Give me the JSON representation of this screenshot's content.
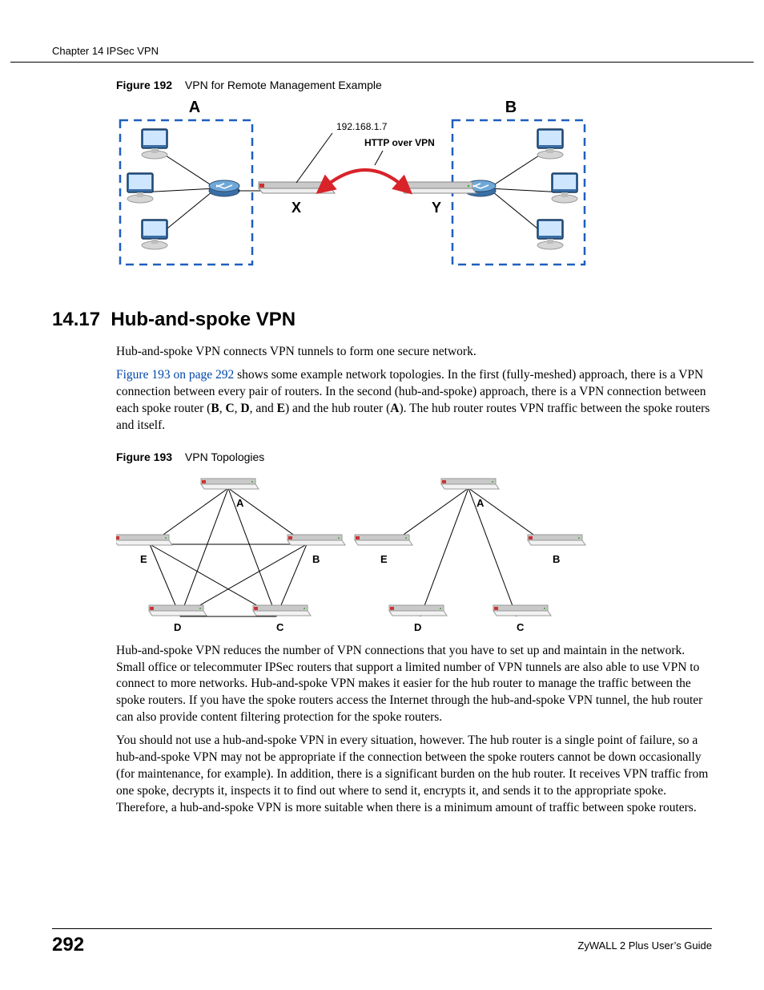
{
  "running_head": "Chapter 14 IPSec VPN",
  "figure192": {
    "label": "Figure 192",
    "title": "VPN for Remote Management Example",
    "site_a": "A",
    "site_b": "B",
    "node_x": "X",
    "node_y": "Y",
    "ip": "192.168.1.7",
    "tunnel_label": "HTTP over VPN"
  },
  "section": {
    "number": "14.17",
    "title": "Hub-and-spoke VPN"
  },
  "p1": "Hub-and-spoke VPN connects VPN tunnels to form one secure network.",
  "p2_xref": "Figure 193 on page 292",
  "p2_after_xref": " shows some example network topologies. In the first (fully-meshed) approach, there is a VPN connection between every pair of routers. In the second (hub-and-spoke) approach, there is a VPN connection between each spoke router (",
  "p2_b": "B",
  "p2_c": "C",
  "p2_d": "D",
  "p2_and": ", and ",
  "p2_e": "E",
  "p2_tail": ") and the hub router (",
  "p2_a": "A",
  "p2_end": "). The hub router routes VPN traffic between the spoke routers and itself.",
  "figure193": {
    "label": "Figure 193",
    "title": "VPN Topologies",
    "nodes": {
      "a": "A",
      "b": "B",
      "c": "C",
      "d": "D",
      "e": "E"
    }
  },
  "p3": "Hub-and-spoke VPN reduces the number of VPN connections that you have to set up and maintain in the network. Small office or telecommuter IPSec routers that support a limited number of VPN tunnels are also able to use VPN to connect to more networks. Hub-and-spoke VPN makes it easier for the hub router to manage the traffic between the spoke routers. If you have the spoke routers access the Internet through the hub-and-spoke VPN tunnel, the hub router can also provide content filtering protection for the spoke routers.",
  "p4": "You should not use a hub-and-spoke VPN in every situation, however. The hub router is a single point of failure, so a hub-and-spoke VPN may not be appropriate if the connection between the spoke routers cannot be down occasionally (for maintenance, for example). In addition, there is a significant burden on the hub router. It receives VPN traffic from one spoke, decrypts it, inspects it to find out where to send it, encrypts it, and sends it to the appropriate spoke. Therefore, a hub-and-spoke VPN is more suitable when there is a minimum amount of traffic between spoke routers.",
  "footer": {
    "page": "292",
    "guide": "ZyWALL 2 Plus User’s Guide"
  }
}
